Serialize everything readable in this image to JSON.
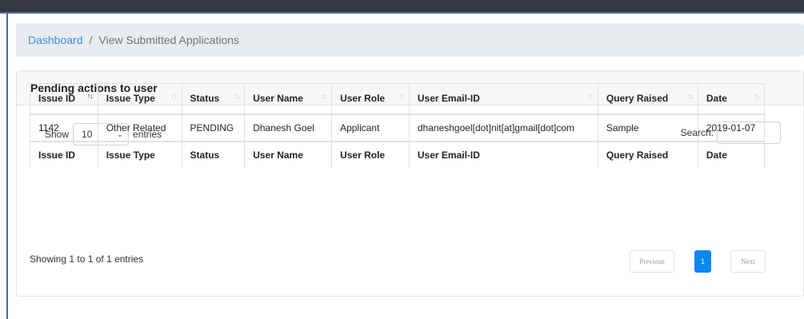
{
  "breadcrumb": {
    "home": "Dashboard",
    "separator": "/",
    "current": "View Submitted Applications"
  },
  "card": {
    "title": "Pending actions to user"
  },
  "length_control": {
    "show_label": "Show",
    "value": "10",
    "entries_label": "entries"
  },
  "search": {
    "label": "Search:",
    "value": ""
  },
  "table": {
    "columns": [
      "Issue ID",
      "Issue Type",
      "Status",
      "User Name",
      "User Role",
      "User Email-ID",
      "Query Raised",
      "Date"
    ],
    "rows": [
      [
        "1142",
        "Other Related",
        "PENDING",
        "Dhanesh Goel",
        "Applicant",
        "dhaneshgoel[dot]nit[at]gmail[dot]com",
        "Sample",
        "2019-01-07"
      ]
    ]
  },
  "info": "Showing 1 to 1 of 1 entries",
  "pagination": {
    "previous": "Previous",
    "current": "1",
    "next": "Next"
  },
  "colors": {
    "link": "#3f8fd8",
    "active_page": "#0d86f0",
    "topbar": "#343a40"
  }
}
